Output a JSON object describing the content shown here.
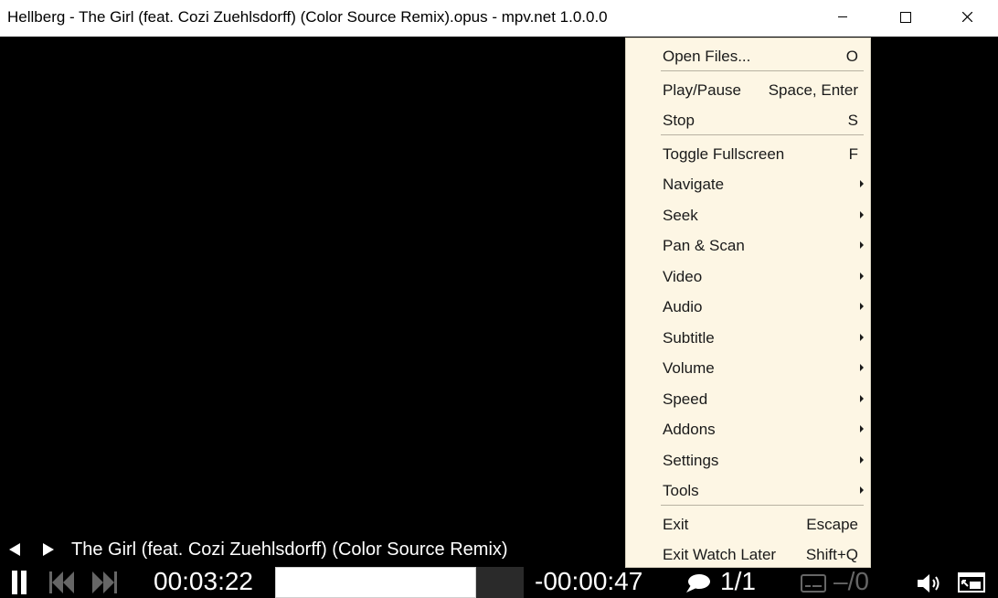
{
  "window": {
    "title": "Hellberg - The Girl (feat. Cozi Zuehlsdorff) (Color Source Remix).opus - mpv.net 1.0.0.0",
    "controls": [
      "minimize-icon",
      "maximize-icon",
      "close-icon"
    ]
  },
  "menu": {
    "items": [
      {
        "label": "Open Files...",
        "shortcut": "O"
      },
      {
        "label": "Play/Pause",
        "shortcut": "Space, Enter"
      },
      {
        "label": "Stop",
        "shortcut": "S"
      },
      {
        "label": "Toggle Fullscreen",
        "shortcut": "F"
      },
      {
        "label": "Navigate",
        "submenu": true
      },
      {
        "label": "Seek",
        "submenu": true
      },
      {
        "label": "Pan & Scan",
        "submenu": true
      },
      {
        "label": "Video",
        "submenu": true
      },
      {
        "label": "Audio",
        "submenu": true
      },
      {
        "label": "Subtitle",
        "submenu": true
      },
      {
        "label": "Volume",
        "submenu": true
      },
      {
        "label": "Speed",
        "submenu": true
      },
      {
        "label": "Addons",
        "submenu": true
      },
      {
        "label": "Settings",
        "submenu": true
      },
      {
        "label": "Tools",
        "submenu": true
      },
      {
        "label": "Exit",
        "shortcut": "Escape"
      },
      {
        "label": "Exit Watch Later",
        "shortcut": "Shift+Q"
      }
    ]
  },
  "osc": {
    "media_title": "The Girl (feat. Cozi Zuehlsdorff) (Color Source Remix)",
    "time_position": "00:03:22",
    "time_remaining": "-00:00:47",
    "seek_progress": 0.81,
    "audio_track": "1/1",
    "subtitle_track": "–/0",
    "icons": [
      "prev-icon",
      "next-icon",
      "pause-icon",
      "skip-back-icon",
      "skip-forward-icon",
      "speech-bubble-icon",
      "subtitle-icon",
      "speaker-icon",
      "window-mode-icon"
    ]
  },
  "colors": {
    "menu_bg": "#fdf6e4",
    "video_bg": "#000000",
    "osc_text": "#ffffff"
  }
}
